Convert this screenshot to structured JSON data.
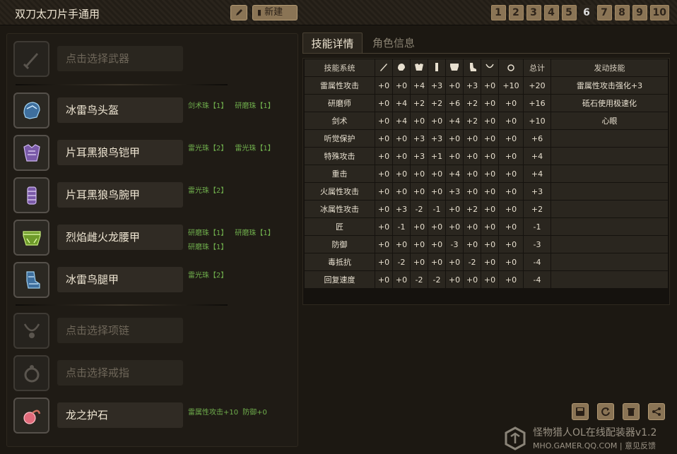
{
  "header": {
    "title": "双刀太刀片手通用",
    "new_label": "新建",
    "pages": [
      "1",
      "2",
      "3",
      "4",
      "5",
      "6",
      "7",
      "8",
      "9",
      "10"
    ],
    "active_page": "6"
  },
  "slots": {
    "weapon": {
      "name": "点击选择武器",
      "icon": "sword-icon"
    },
    "head": {
      "name": "冰雷鸟头盔",
      "gems": [
        "剑术珠【1】",
        "研磨珠【1】"
      ],
      "icon": "helmet-icon"
    },
    "chest": {
      "name": "片耳黑狼鸟铠甲",
      "gems": [
        "雷光珠【2】",
        "雷光珠【1】"
      ],
      "icon": "chest-armor-icon"
    },
    "arms": {
      "name": "片耳黑狼鸟腕甲",
      "gems": [
        "雷光珠【2】"
      ],
      "icon": "gauntlet-icon"
    },
    "waist": {
      "name": "烈焰雌火龙腰甲",
      "gems": [
        "研磨珠【1】",
        "研磨珠【1】",
        "研磨珠【1】"
      ],
      "icon": "waist-armor-icon"
    },
    "legs": {
      "name": "冰雷鸟腿甲",
      "gems": [
        "雷光珠【2】"
      ],
      "icon": "leg-armor-icon"
    },
    "necklace": {
      "name": "点击选择项链",
      "icon": "necklace-icon"
    },
    "ring": {
      "name": "点击选择戒指",
      "icon": "ring-icon"
    },
    "talisman": {
      "name": "龙之护石",
      "gems": [
        "雷属性攻击+10",
        "防御+0"
      ],
      "icon": "talisman-icon"
    }
  },
  "tabs": {
    "skills": "技能详情",
    "character": "角色信息"
  },
  "table": {
    "headers": {
      "skill_system": "技能系统",
      "total": "总计",
      "active_skill": "发动技能"
    },
    "column_icons": [
      "weapon-icon",
      "helmet-icon",
      "chest-armor-icon",
      "gauntlet-icon",
      "waist-armor-icon",
      "leg-armor-icon",
      "necklace-icon",
      "ring-icon"
    ],
    "rows": [
      {
        "skill": "雷属性攻击",
        "values": [
          "+0",
          "+0",
          "+4",
          "+3",
          "+0",
          "+3",
          "+0",
          "+10"
        ],
        "total": "+20",
        "active": "雷属性攻击强化+3"
      },
      {
        "skill": "研磨师",
        "values": [
          "+0",
          "+4",
          "+2",
          "+2",
          "+6",
          "+2",
          "+0",
          "+0"
        ],
        "total": "+16",
        "active": "砥石使用极速化"
      },
      {
        "skill": "剑术",
        "values": [
          "+0",
          "+4",
          "+0",
          "+0",
          "+4",
          "+2",
          "+0",
          "+0"
        ],
        "total": "+10",
        "active": "心眼"
      },
      {
        "skill": "听觉保护",
        "values": [
          "+0",
          "+0",
          "+3",
          "+3",
          "+0",
          "+0",
          "+0",
          "+0"
        ],
        "total": "+6",
        "active": ""
      },
      {
        "skill": "特殊攻击",
        "values": [
          "+0",
          "+0",
          "+3",
          "+1",
          "+0",
          "+0",
          "+0",
          "+0"
        ],
        "total": "+4",
        "active": ""
      },
      {
        "skill": "重击",
        "values": [
          "+0",
          "+0",
          "+0",
          "+0",
          "+4",
          "+0",
          "+0",
          "+0"
        ],
        "total": "+4",
        "active": ""
      },
      {
        "skill": "火属性攻击",
        "values": [
          "+0",
          "+0",
          "+0",
          "+0",
          "+3",
          "+0",
          "+0",
          "+0"
        ],
        "total": "+3",
        "active": ""
      },
      {
        "skill": "冰属性攻击",
        "values": [
          "+0",
          "+3",
          "-2",
          "-1",
          "+0",
          "+2",
          "+0",
          "+0"
        ],
        "total": "+2",
        "active": ""
      },
      {
        "skill": "匠",
        "values": [
          "+0",
          "-1",
          "+0",
          "+0",
          "+0",
          "+0",
          "+0",
          "+0"
        ],
        "total": "-1",
        "active": ""
      },
      {
        "skill": "防御",
        "values": [
          "+0",
          "+0",
          "+0",
          "+0",
          "-3",
          "+0",
          "+0",
          "+0"
        ],
        "total": "-3",
        "active": ""
      },
      {
        "skill": "毒抵抗",
        "values": [
          "+0",
          "-2",
          "+0",
          "+0",
          "+0",
          "-2",
          "+0",
          "+0"
        ],
        "total": "-4",
        "active": ""
      },
      {
        "skill": "回复速度",
        "values": [
          "+0",
          "+0",
          "-2",
          "-2",
          "+0",
          "+0",
          "+0",
          "+0"
        ],
        "total": "-4",
        "active": ""
      }
    ]
  },
  "footer": {
    "tools": [
      "save-icon",
      "refresh-icon",
      "trash-icon",
      "share-icon"
    ],
    "brand_name": "怪物猎人OL在线配装器v1.2",
    "brand_site": "MHO.GAMER.QQ.COM",
    "brand_sep": " | ",
    "brand_feedback": "意见反馈"
  },
  "colors": {
    "background": "#1c1812",
    "gem_text": "#6fae4c",
    "button": "#8a7455"
  }
}
